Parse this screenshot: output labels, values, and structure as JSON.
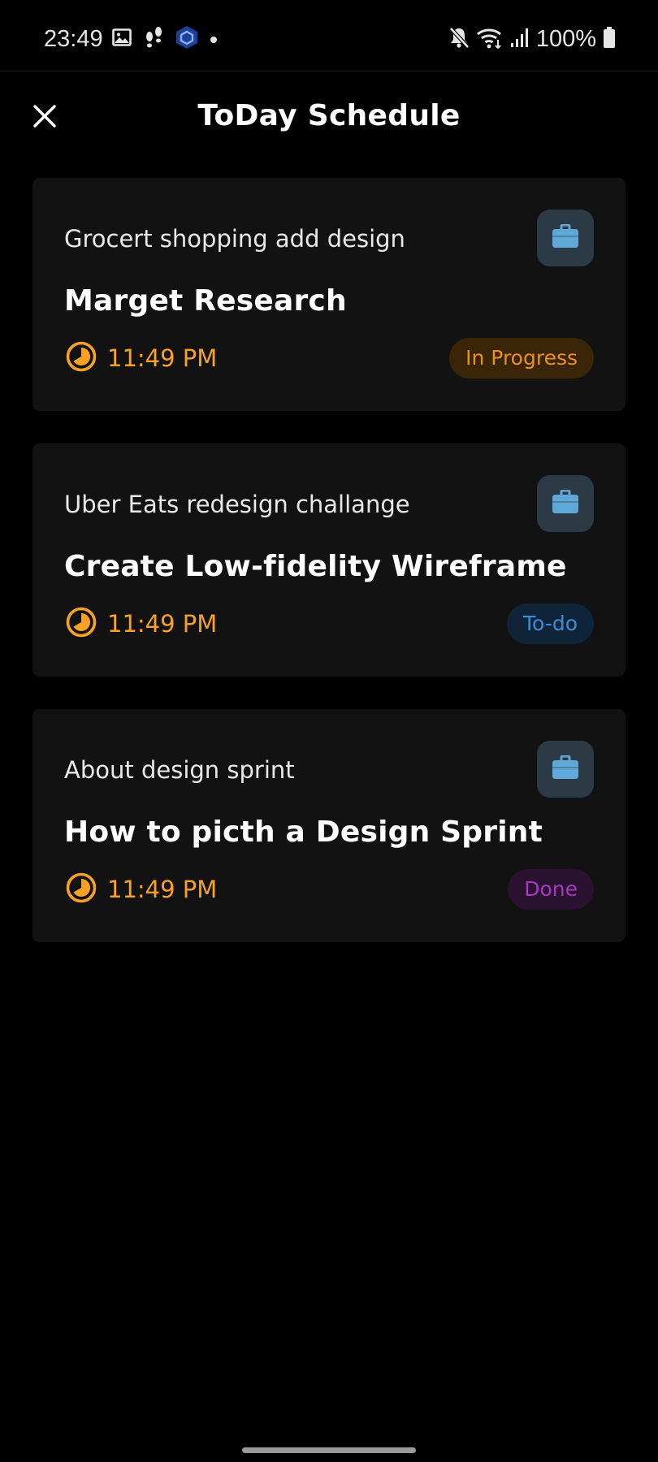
{
  "status_bar": {
    "time": "23:49",
    "battery": "100%",
    "left_icons": [
      "gallery-icon",
      "footsteps-icon",
      "app-cube-icon",
      "notification-dot-icon"
    ],
    "right_icons": [
      "mute-icon",
      "wifi-icon",
      "signal-icon",
      "battery-icon"
    ]
  },
  "header": {
    "title": "ToDay Schedule",
    "close_icon": "close-icon"
  },
  "colors": {
    "background": "#000000",
    "card": "#121212",
    "accent_orange": "#f7a125",
    "category_button_bg": "#2c3a45",
    "category_icon": "#5fa8d8"
  },
  "tasks": [
    {
      "subtitle": "Grocert shopping add design",
      "title": "Marget Research",
      "time": "11:49 PM",
      "status": "In Progress",
      "status_color": "#e8911e",
      "status_bg": "#3a2508",
      "category_icon": "briefcase-icon"
    },
    {
      "subtitle": "Uber Eats redesign challange",
      "title": "Create Low-fidelity Wireframe",
      "time": "11:49 PM",
      "status": "To-do",
      "status_color": "#3c8ed8",
      "status_bg": "#0f2438",
      "category_icon": "briefcase-icon"
    },
    {
      "subtitle": "About design sprint",
      "title": "How to picth a Design Sprint",
      "time": "11:49 PM",
      "status": "Done",
      "status_color": "#a43bbd",
      "status_bg": "#2a1230",
      "category_icon": "briefcase-icon"
    }
  ]
}
